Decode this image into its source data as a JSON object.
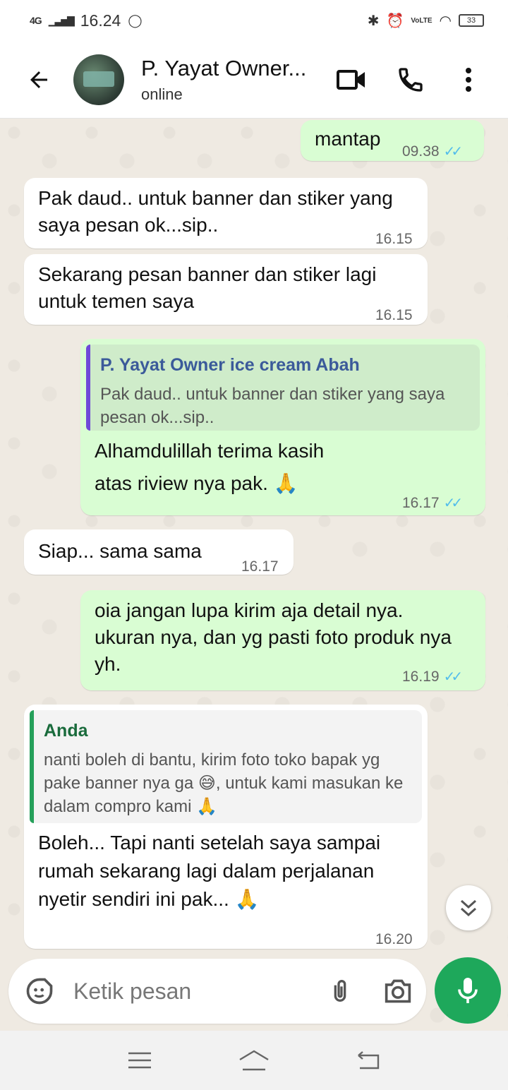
{
  "status_bar": {
    "network": "4G",
    "time": "16.24",
    "battery": "33",
    "lte": "VoLTE"
  },
  "header": {
    "contact_name": "P. Yayat Owner...",
    "contact_status": "online"
  },
  "messages": [
    {
      "side": "out",
      "text": "mantap",
      "time": "09.38"
    },
    {
      "side": "in",
      "text": "Pak daud.. untuk banner  dan stiker yang saya pesan ok...sip..",
      "time": "16.15"
    },
    {
      "side": "in",
      "text": "Sekarang pesan banner dan stiker lagi untuk temen saya",
      "time": "16.15"
    },
    {
      "side": "out",
      "quote_name": "P. Yayat Owner ice cream Abah",
      "quote_text": "Pak daud.. untuk banner  dan stiker yang saya pesan ok...sip..",
      "text": "Alhamdulillah terima kasih atas riview nya pak. 🙏",
      "time": "16.17"
    },
    {
      "side": "in",
      "text": "Siap... sama sama",
      "time": "16.17"
    },
    {
      "side": "out",
      "text": "oia jangan lupa kirim aja detail nya. ukuran nya, dan yg pasti foto produk nya yh.",
      "time": "16.19"
    },
    {
      "side": "in",
      "quote_name": "Anda",
      "quote_text": "nanti boleh di bantu, kirim foto toko bapak yg pake banner nya ga 😅, untuk kami masukan ke dalam compro kami 🙏",
      "text": "Boleh... Tapi nanti setelah saya sampai rumah sekarang lagi dalam perjalanan nyetir sendiri ini pak... 🙏",
      "time": "16.20"
    }
  ],
  "input": {
    "placeholder": "Ketik pesan"
  },
  "colors": {
    "outgoing_bubble": "#d9fdd3",
    "incoming_bubble": "#ffffff",
    "accent_green": "#1ea85b",
    "read_ticks": "#53bdeb"
  }
}
